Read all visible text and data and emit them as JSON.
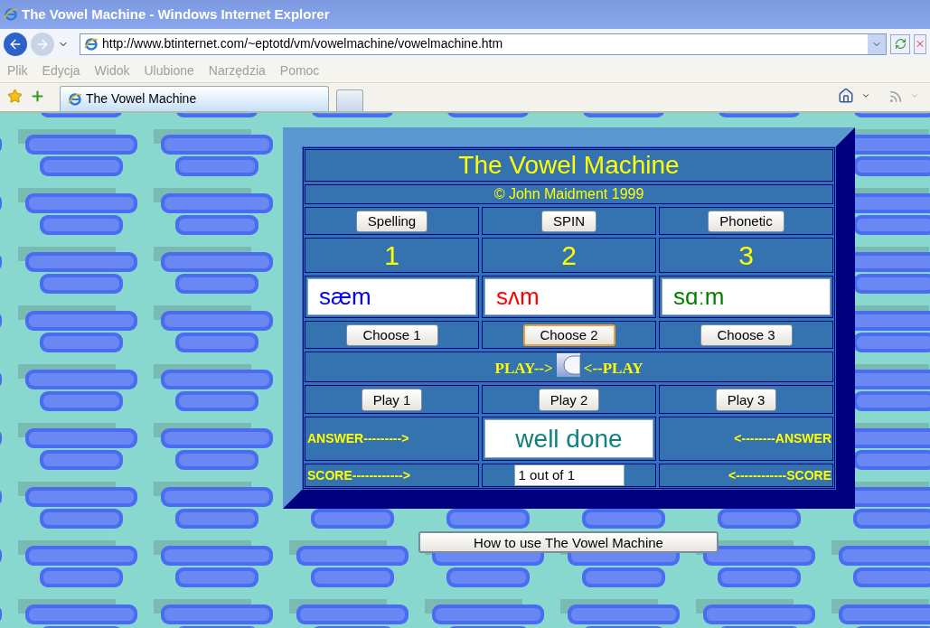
{
  "window": {
    "title": "The Vowel Machine - Windows Internet Explorer"
  },
  "address_bar": {
    "url": "http://www.btinternet.com/~eptotd/vm/vowelmachine/vowelmachine.htm"
  },
  "menu": [
    "Plik",
    "Edycja",
    "Widok",
    "Ulubione",
    "Narzędzia",
    "Pomoc"
  ],
  "tabs": [
    {
      "label": "The Vowel Machine",
      "selected": true
    }
  ],
  "machine": {
    "title": "The Vowel Machine",
    "copyright": "© John Maidment 1999",
    "mode_buttons": [
      "Spelling",
      "SPIN",
      "Phonetic"
    ],
    "numbers": [
      "1",
      "2",
      "3"
    ],
    "words": [
      {
        "text": "sæm",
        "color": "#0000ff"
      },
      {
        "text": "sʌm",
        "color": "#ff0000"
      },
      {
        "text": "sɑːm",
        "color": "#008000"
      }
    ],
    "choose_buttons": [
      {
        "label": "Choose 1",
        "selected": false
      },
      {
        "label": "Choose 2",
        "selected": true
      },
      {
        "label": "Choose 3",
        "selected": false
      }
    ],
    "play_left": "PLAY-->",
    "play_right": "<--PLAY",
    "play_buttons": [
      "Play 1",
      "Play 2",
      "Play 3"
    ],
    "answer_left": "ANSWER--------->",
    "answer": "well done",
    "answer_right": "<--------ANSWER",
    "score_left": "SCORE------------>",
    "score": "1 out of 1",
    "score_right": "<------------SCORE"
  },
  "help_button": "How to use The Vowel Machine"
}
